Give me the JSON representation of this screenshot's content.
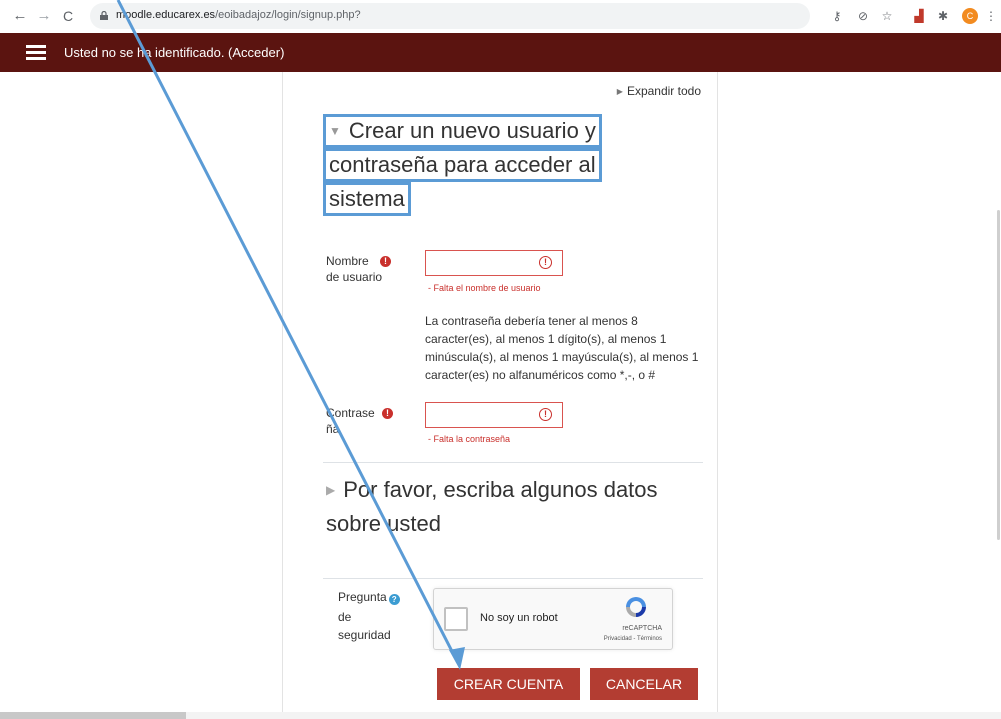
{
  "browser": {
    "url_host": "moodle.educarex.es",
    "url_path": "/eoibadajoz/login/signup.php?",
    "profile_initial": "C"
  },
  "navbar": {
    "login_status": "Usted no se ha identificado. (Acceder)"
  },
  "form": {
    "expand_all": "Expandir todo",
    "section1_title_lines": [
      "Crear un nuevo usuario y",
      "contraseña para acceder al",
      "sistema"
    ],
    "username_label": [
      "Nombre",
      "de usuario"
    ],
    "username_error": "- Falta el nombre de usuario",
    "password_rules": "La contraseña debería tener al menos 8 caracter(es), al menos 1 dígito(s), al menos 1 minúscula(s), al menos 1 mayúscula(s), al menos 1 caracter(es) no alfanuméricos como *,-, o #",
    "password_label": [
      "Contrase",
      "ña"
    ],
    "password_error": "- Falta la contraseña",
    "section2_title_lines": [
      "Por favor, escriba algunos datos",
      "sobre usted"
    ],
    "security_label": [
      "Pregunta",
      "de",
      "seguridad"
    ],
    "captcha_text": "No soy un robot",
    "captcha_brand": "reCAPTCHA",
    "captcha_links": "Privacidad - Términos",
    "create_button": "CREAR CUENTA",
    "cancel_button": "CANCELAR"
  },
  "colors": {
    "navbar": "#5b1410",
    "button": "#b33d32",
    "error": "#c9302c",
    "annotation": "#5b9bd5"
  }
}
